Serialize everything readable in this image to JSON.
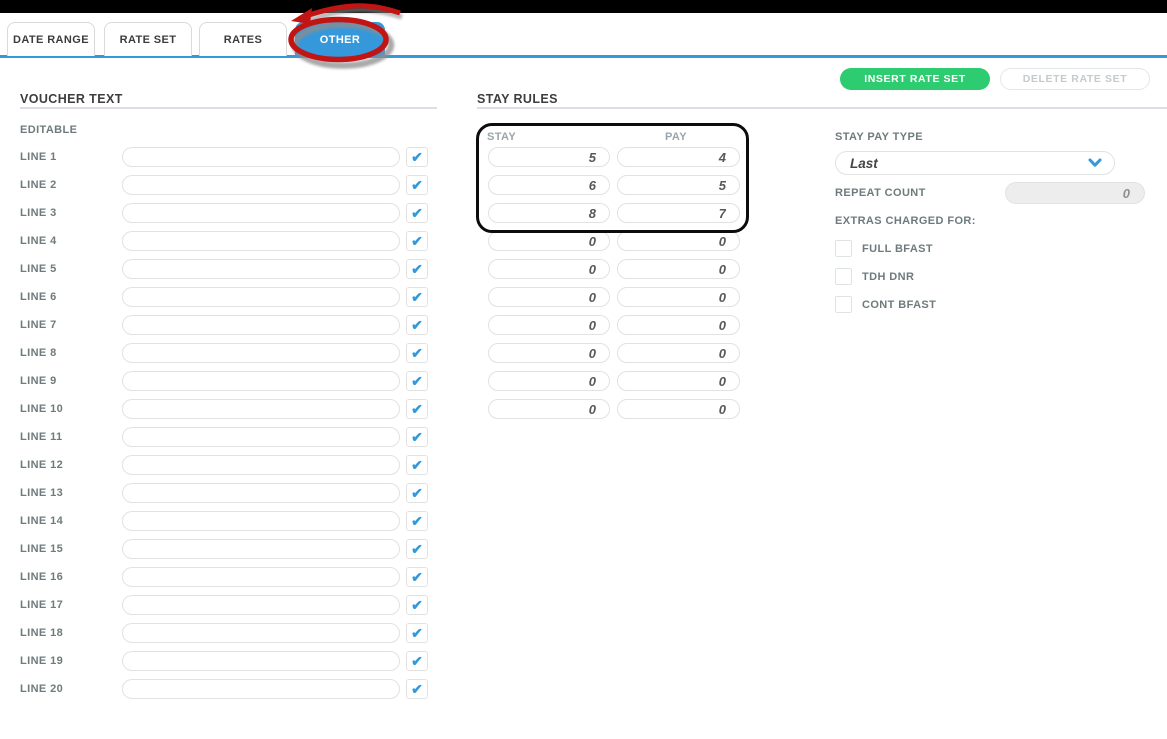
{
  "colors": {
    "accent_blue": "#3598db",
    "button_green": "#2ecc71",
    "annotation_red": "#c31414",
    "annotation_black": "#0c0c0c",
    "check_blue": "#3598db"
  },
  "tabs": [
    {
      "label": "DATE RANGE",
      "active": false
    },
    {
      "label": "RATE SET",
      "active": false
    },
    {
      "label": "RATES",
      "active": false
    },
    {
      "label": "OTHER",
      "active": true
    }
  ],
  "toolbar": {
    "insert_label": "INSERT RATE SET",
    "delete_label": "DELETE RATE SET"
  },
  "voucher": {
    "title": "VOUCHER TEXT",
    "subtitle": "EDITABLE",
    "lines": [
      {
        "label": "LINE 1",
        "value": "",
        "checked": true
      },
      {
        "label": "LINE 2",
        "value": "",
        "checked": true
      },
      {
        "label": "LINE 3",
        "value": "",
        "checked": true
      },
      {
        "label": "LINE 4",
        "value": "",
        "checked": true
      },
      {
        "label": "LINE 5",
        "value": "",
        "checked": true
      },
      {
        "label": "LINE 6",
        "value": "",
        "checked": true
      },
      {
        "label": "LINE 7",
        "value": "",
        "checked": true
      },
      {
        "label": "LINE 8",
        "value": "",
        "checked": true
      },
      {
        "label": "LINE 9",
        "value": "",
        "checked": true
      },
      {
        "label": "LINE 10",
        "value": "",
        "checked": true
      },
      {
        "label": "LINE 11",
        "value": "",
        "checked": true
      },
      {
        "label": "LINE 12",
        "value": "",
        "checked": true
      },
      {
        "label": "LINE 13",
        "value": "",
        "checked": true
      },
      {
        "label": "LINE 14",
        "value": "",
        "checked": true
      },
      {
        "label": "LINE 15",
        "value": "",
        "checked": true
      },
      {
        "label": "LINE 16",
        "value": "",
        "checked": true
      },
      {
        "label": "LINE 17",
        "value": "",
        "checked": true
      },
      {
        "label": "LINE 18",
        "value": "",
        "checked": true
      },
      {
        "label": "LINE 19",
        "value": "",
        "checked": true
      },
      {
        "label": "LINE 20",
        "value": "",
        "checked": true
      }
    ]
  },
  "stay_rules": {
    "title": "STAY RULES",
    "stay_header": "STAY",
    "pay_header": "PAY",
    "annotated_rows": 3,
    "rows": [
      {
        "stay": "5",
        "pay": "4"
      },
      {
        "stay": "6",
        "pay": "5"
      },
      {
        "stay": "8",
        "pay": "7"
      },
      {
        "stay": "0",
        "pay": "0"
      },
      {
        "stay": "0",
        "pay": "0"
      },
      {
        "stay": "0",
        "pay": "0"
      },
      {
        "stay": "0",
        "pay": "0"
      },
      {
        "stay": "0",
        "pay": "0"
      },
      {
        "stay": "0",
        "pay": "0"
      },
      {
        "stay": "0",
        "pay": "0"
      }
    ]
  },
  "settings": {
    "stay_pay_type_label": "STAY PAY TYPE",
    "stay_pay_type_value": "Last",
    "repeat_count_label": "REPEAT COUNT",
    "repeat_count_value": "0",
    "extras_label": "EXTRAS CHARGED FOR:",
    "extras": [
      {
        "label": "FULL BFAST",
        "checked": false
      },
      {
        "label": "TDH DNR",
        "checked": false
      },
      {
        "label": "CONT BFAST",
        "checked": false
      }
    ]
  }
}
